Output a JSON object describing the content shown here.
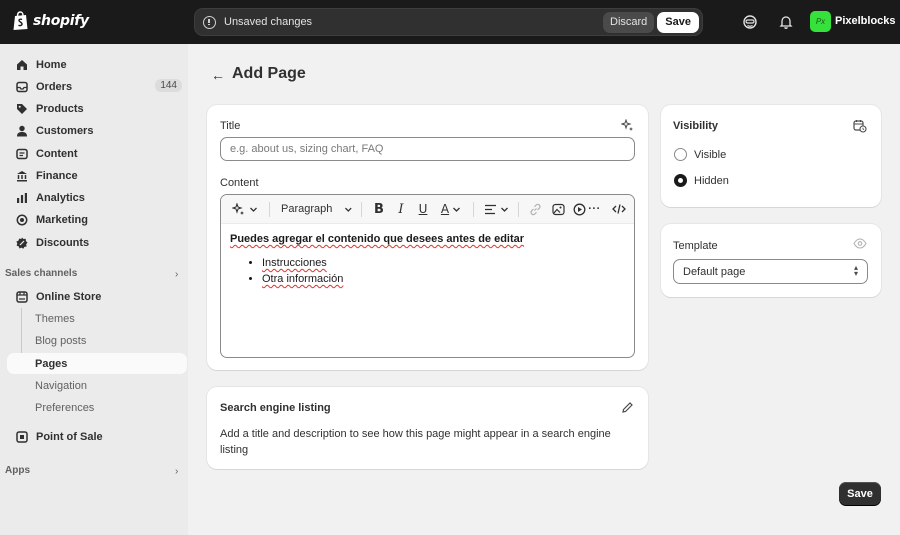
{
  "topbar": {
    "logo_text": "shopify",
    "unsaved_text": "Unsaved changes",
    "discard_label": "Discard",
    "save_label": "Save",
    "store_initials": "Px",
    "store_name": "Pixelblocks"
  },
  "sidebar": {
    "items": [
      {
        "label": "Home",
        "icon": "home-icon"
      },
      {
        "label": "Orders",
        "icon": "inbox-icon",
        "badge": "144"
      },
      {
        "label": "Products",
        "icon": "tag-icon"
      },
      {
        "label": "Customers",
        "icon": "person-icon"
      },
      {
        "label": "Content",
        "icon": "content-icon"
      },
      {
        "label": "Finance",
        "icon": "bank-icon"
      },
      {
        "label": "Analytics",
        "icon": "bar-chart-icon"
      },
      {
        "label": "Marketing",
        "icon": "target-icon"
      },
      {
        "label": "Discounts",
        "icon": "discount-icon"
      }
    ],
    "sales_channels_label": "Sales channels",
    "online_store_label": "Online Store",
    "online_store_subitems": [
      "Themes",
      "Blog posts",
      "Pages",
      "Navigation",
      "Preferences"
    ],
    "active_subitem": "Pages",
    "point_of_sale_label": "Point of Sale",
    "apps_label": "Apps"
  },
  "main": {
    "page_title": "Add Page",
    "title_label": "Title",
    "title_placeholder": "e.g. about us, sizing chart, FAQ",
    "content_label": "Content",
    "toolbar": {
      "paragraph_label": "Paragraph"
    },
    "editor": {
      "heading": "Puedes agregar el contenido que desees antes de editar",
      "list_items": [
        "Instrucciones",
        "Otra información"
      ]
    },
    "seo": {
      "heading": "Search engine listing",
      "description": "Add a title and description to see how this page might appear in a search engine listing"
    },
    "save_label": "Save"
  },
  "visibility": {
    "heading": "Visibility",
    "options": [
      "Visible",
      "Hidden"
    ],
    "selected": "Hidden"
  },
  "template": {
    "heading": "Template",
    "selected": "Default page"
  }
}
